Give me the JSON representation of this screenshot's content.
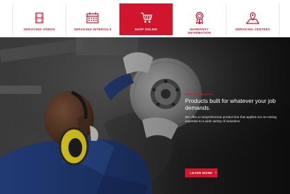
{
  "nav": {
    "items": [
      {
        "label": "SERVICING VIDEOS",
        "icon": "film-icon"
      },
      {
        "label": "SERVICING INTERVALS",
        "icon": "calendar-icon"
      },
      {
        "label": "SHOP ONLINE",
        "icon": "shopping-cart-icon",
        "active": true
      },
      {
        "label": "WARRANTY\nINFORMATION",
        "icon": "award-ribbon-icon"
      },
      {
        "label": "SERVICING CENTERS",
        "icon": "map-pin-icon"
      }
    ]
  },
  "hero": {
    "eyebrow": "OUR PRODUCTS",
    "heading": "Products built for whatever your job demands.",
    "body": "We offer a comprehensive product line that applies our on-mining expertise to a wide variety of industries.",
    "cta_label": "LEARN MORE",
    "cta_icon": "chevron-right-icon"
  },
  "colors": {
    "brand_red": "#d0152c",
    "nav_text": "#c8102e",
    "hero_text": "#ffffff"
  }
}
